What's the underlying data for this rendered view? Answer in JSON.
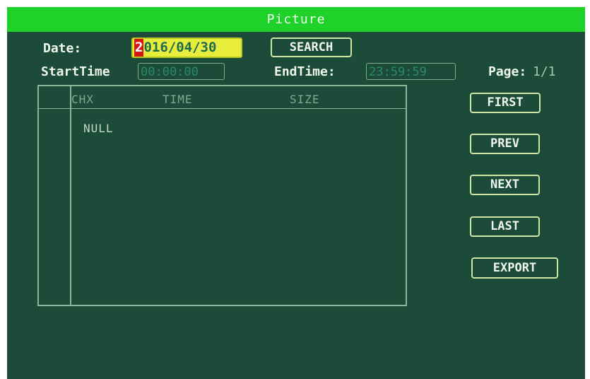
{
  "window": {
    "title": "Picture"
  },
  "search": {
    "date_label": "Date:",
    "date_cursor_char": "2",
    "date_rest": "016/04/30",
    "search_button": "SEARCH",
    "start_label": "StartTime",
    "start_value": "00:00:00",
    "end_label": "EndTime:",
    "end_value": "23:59:59",
    "page_label": "Page:",
    "page_value": "1/1"
  },
  "table": {
    "columns": [
      "CHX",
      "TIME",
      "SIZE"
    ],
    "empty_text": "NULL"
  },
  "nav": {
    "first": "FIRST",
    "prev": "PREV",
    "next": "NEXT",
    "last": "LAST",
    "export": "EXPORT"
  },
  "colors": {
    "background": "#1c4b39",
    "titlebar": "#1fd22a",
    "date_highlight": "#e8ec3a",
    "cursor": "#d81515",
    "button_border": "#cfe6a8"
  }
}
